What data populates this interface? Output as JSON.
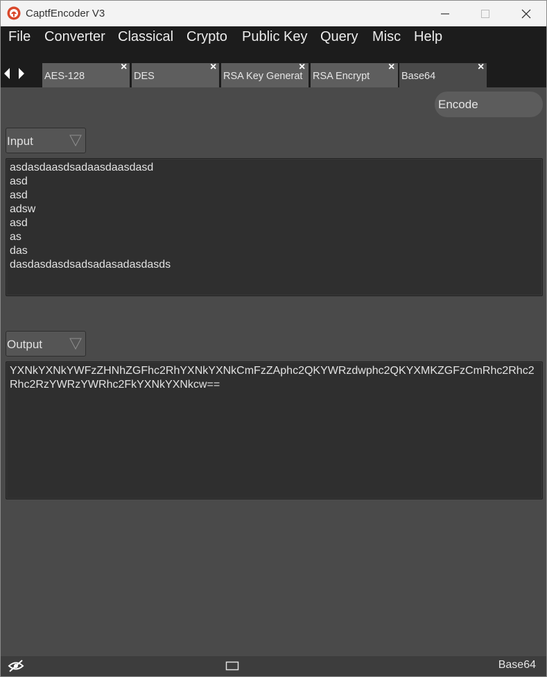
{
  "window": {
    "title": "CaptfEncoder V3",
    "logo_icon": "captf-logo-icon"
  },
  "menu": {
    "items": [
      "File",
      "Converter",
      "Classical",
      "Crypto",
      "Public Key",
      "Query",
      "Misc",
      "Help"
    ]
  },
  "tabs": {
    "items": [
      {
        "label": "AES-128",
        "active": false
      },
      {
        "label": "DES",
        "active": false
      },
      {
        "label": "RSA Key Generat",
        "active": false
      },
      {
        "label": "RSA Encrypt",
        "active": false
      },
      {
        "label": "Base64",
        "active": true
      }
    ]
  },
  "toolbar": {
    "encode_label": "Encode"
  },
  "input": {
    "selector_label": "Input",
    "lines": [
      "asdasdaasdsadaasdaasdasd",
      "asd",
      "asd",
      "adsw",
      "asd",
      "as",
      "das",
      "dasdasdasdsadsadasadasdasds"
    ]
  },
  "output": {
    "selector_label": "Output",
    "text": "YXNkYXNkYWFzZHNhZGFhc2RhYXNkYXNkCmFzZAphc2QKYWRzdwphc2QKYXMKZGFzCmRhc2Rhc2Rhc2RzYWRzYWRhc2FkYXNkYXNkcw=="
  },
  "status": {
    "right_label": "Base64"
  },
  "colors": {
    "background": "#4a4a4a",
    "menubar": "#1c1c1c",
    "textarea": "#2f2f2f",
    "accent_logo": "#d9482b"
  }
}
